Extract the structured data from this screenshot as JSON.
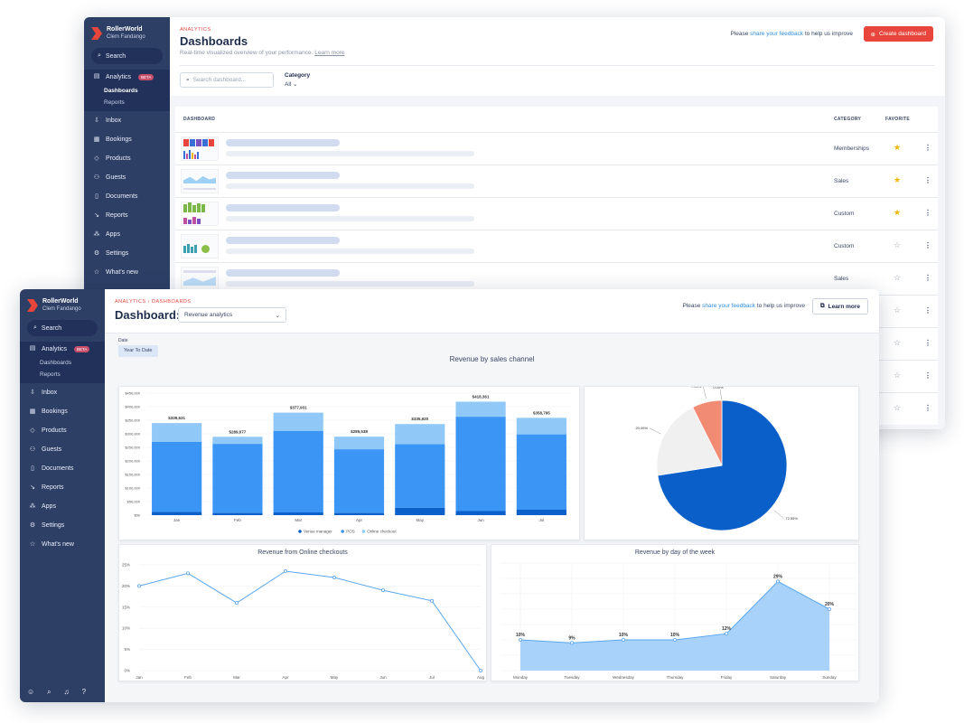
{
  "back_window": {
    "sidebar": {
      "brand": "RollerWorld",
      "user": "Clem Fandango",
      "search": "Search",
      "analytics": "Analytics",
      "beta": "BETA",
      "sub": [
        "Dashboards",
        "Reports"
      ],
      "items": [
        {
          "label": "Inbox",
          "icon": "inbox-icon",
          "glyph": "⇩"
        },
        {
          "label": "Bookings",
          "icon": "calendar-icon",
          "glyph": "▦"
        },
        {
          "label": "Products",
          "icon": "tag-icon",
          "glyph": "◇"
        },
        {
          "label": "Guests",
          "icon": "guests-icon",
          "glyph": "⚇"
        },
        {
          "label": "Documents",
          "icon": "document-icon",
          "glyph": "▯"
        },
        {
          "label": "Reports",
          "icon": "trend-icon",
          "glyph": "↘"
        },
        {
          "label": "Apps",
          "icon": "apps-icon",
          "glyph": "⁂"
        },
        {
          "label": "Settings",
          "icon": "gear-icon",
          "glyph": "⚙"
        },
        {
          "label": "What's new",
          "icon": "star-icon",
          "glyph": "☆"
        }
      ]
    },
    "header": {
      "overline": "ANALYTICS",
      "title": "Dashboards",
      "description": "Real-time visualized overview of your performance.",
      "learn_more": "Learn more",
      "feedback_pre": "Please",
      "feedback_link": "share your feedback",
      "feedback_post": "to help us improve",
      "create_button": "Create dashboard"
    },
    "filters": {
      "search_placeholder": "Search dashboard...",
      "category_label": "Category",
      "category_value": "All"
    },
    "table": {
      "col_dashboard": "DASHBOARD",
      "col_category": "CATEGORY",
      "col_favorite": "FAVORITE",
      "rows": [
        {
          "category": "Memberships",
          "favorite": true
        },
        {
          "category": "Sales",
          "favorite": true
        },
        {
          "category": "Custom",
          "favorite": true
        },
        {
          "category": "Custom",
          "favorite": false
        },
        {
          "category": "Sales",
          "favorite": false
        },
        {
          "category": "",
          "favorite": false
        },
        {
          "category": "",
          "favorite": false
        },
        {
          "category": "",
          "favorite": false
        },
        {
          "category": "",
          "favorite": false
        }
      ]
    }
  },
  "front_window": {
    "sidebar": {
      "brand": "RollerWorld",
      "user": "Clem Fandango",
      "search": "Search",
      "analytics": "Analytics",
      "beta": "BETA",
      "sub": [
        "Dashboards",
        "Reports"
      ],
      "items": [
        {
          "label": "Inbox",
          "icon": "inbox-icon",
          "glyph": "⇩"
        },
        {
          "label": "Bookings",
          "icon": "calendar-icon",
          "glyph": "▦"
        },
        {
          "label": "Products",
          "icon": "tag-icon",
          "glyph": "◇"
        },
        {
          "label": "Guests",
          "icon": "guests-icon",
          "glyph": "⚇"
        },
        {
          "label": "Documents",
          "icon": "document-icon",
          "glyph": "▯"
        },
        {
          "label": "Reports",
          "icon": "trend-icon",
          "glyph": "↘"
        },
        {
          "label": "Apps",
          "icon": "apps-icon",
          "glyph": "⁂"
        },
        {
          "label": "Settings",
          "icon": "gear-icon",
          "glyph": "⚙"
        },
        {
          "label": "What's new",
          "icon": "star-icon",
          "glyph": "☆"
        }
      ]
    },
    "breadcrumb": [
      "ANALYTICS",
      "DASHBOARDS"
    ],
    "title": "Dashboard:",
    "dashboard_select": "Revenue analytics",
    "feedback_pre": "Please",
    "feedback_link": "share your feedback",
    "feedback_post": "to help us improve",
    "learn_more_button": "Learn more",
    "date_label": "Date",
    "date_value": "Year To Date",
    "section_title": "Revenue by sales channel"
  },
  "colors": {
    "sidebar": "#2e3f66",
    "accent": "#e8453c",
    "venue": "#0a5fc9",
    "pos": "#3a95f5",
    "online": "#90c8f8",
    "star": "#f5b400"
  },
  "chart_data": [
    {
      "type": "bar",
      "stacked": true,
      "categories": [
        "Jan",
        "Feb",
        "Mar",
        "Apr",
        "May",
        "Jun",
        "Jul"
      ],
      "series": [
        {
          "name": "Venue manager",
          "values": [
            12000,
            8000,
            10000,
            8000,
            27000,
            15000,
            20000
          ]
        },
        {
          "name": "POS",
          "values": [
            258000,
            255000,
            301000,
            235000,
            235000,
            348000,
            278000
          ]
        },
        {
          "name": "Online checkout",
          "values": [
            69631,
            26077,
            66931,
            46538,
            73920,
            55361,
            60795
          ]
        }
      ],
      "totals": [
        "$339,631",
        "$289,077",
        "$377,931",
        "$289,538",
        "$335,920",
        "$418,361",
        "$358,795"
      ],
      "yticks": [
        "$0k",
        "$50,000",
        "$100,000",
        "$150,000",
        "$200,000",
        "$250,000",
        "$300,000",
        "$350,000",
        "$400,000",
        "$450,000"
      ],
      "ylim": [
        0,
        450000
      ],
      "legend": "bottom"
    },
    {
      "type": "pie",
      "values": [
        72.55,
        20.06,
        7.39
      ],
      "colors": [
        "#0a5fc9",
        "#f0f0f0",
        "#f28b74"
      ],
      "labels": [
        "72.55%",
        "20.06%",
        "7.39%"
      ],
      "extra_label": "0.00%"
    },
    {
      "type": "line",
      "title": "Revenue from Online checkouts",
      "x": [
        "Jan",
        "Feb",
        "Mar",
        "Apr",
        "May",
        "Jun",
        "Jul",
        "Aug"
      ],
      "values": [
        20,
        23,
        16,
        23.5,
        22,
        19,
        16.5,
        0
      ],
      "yticks": [
        "0%",
        "5%",
        "10%",
        "15%",
        "20%",
        "25%"
      ],
      "ylim": [
        0,
        25
      ]
    },
    {
      "type": "area",
      "title": "Revenue by day of the week",
      "x": [
        "Monday",
        "Tuesday",
        "Wednesday",
        "Thursday",
        "Friday",
        "Saturday",
        "Sunday"
      ],
      "values": [
        10,
        9,
        10,
        10,
        12,
        29,
        20
      ],
      "labels": [
        "10%",
        "9%",
        "10%",
        "10%",
        "12%",
        "29%",
        "20%"
      ],
      "ylim": [
        0,
        35
      ]
    }
  ],
  "footer_icons": [
    "user-icon",
    "search-icon",
    "bell-icon",
    "help-icon"
  ]
}
